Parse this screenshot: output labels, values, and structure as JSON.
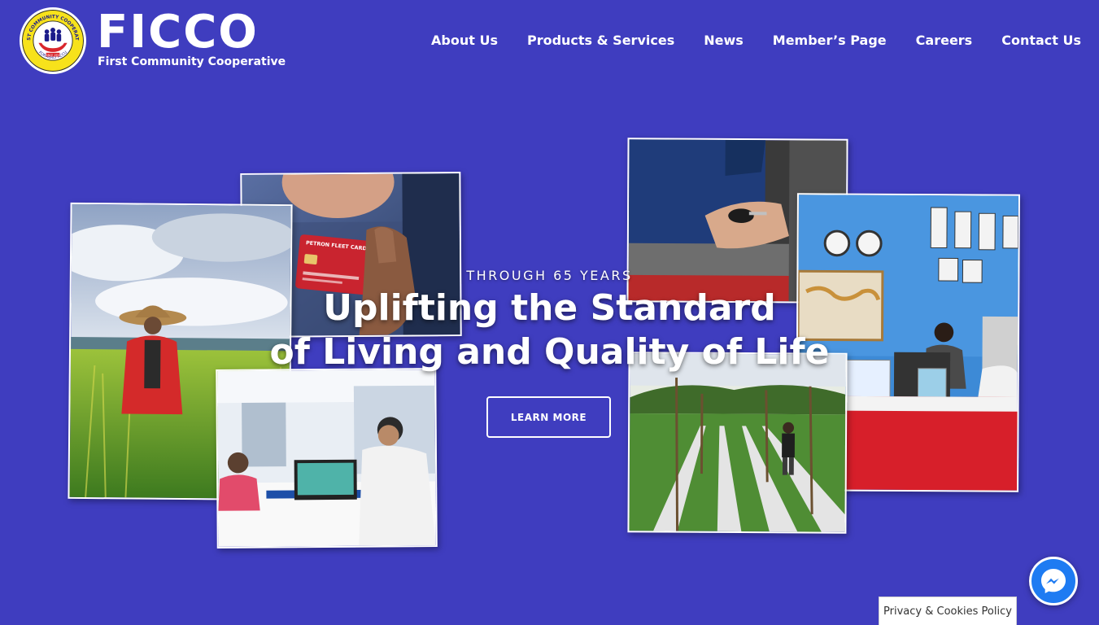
{
  "header": {
    "seal": {
      "ring_top_text": "FIRST COMMUNITY COOPERATIVE",
      "ring_bottom_text": "FORMERLY ACCU",
      "badge_text": "SINCE 1954"
    },
    "brand_name": "FICCO",
    "tagline": "First Community Cooperative"
  },
  "nav": {
    "items": [
      {
        "label": "About Us"
      },
      {
        "label": "Products & Services"
      },
      {
        "label": "News"
      },
      {
        "label": "Member’s Page"
      },
      {
        "label": "Careers"
      },
      {
        "label": "Contact Us"
      }
    ]
  },
  "hero": {
    "kicker": "THROUGH 65 YEARS",
    "title_line1": "Uplifting the Standard",
    "title_line2": "of Living and Quality of Life",
    "cta_label": "LEARN MORE",
    "photo_card_text": "PETRON FLEET CARD"
  },
  "widgets": {
    "privacy_label": "Privacy & Cookies Policy",
    "messenger_icon": "messenger-icon"
  },
  "colors": {
    "background": "#3f3dbf",
    "text": "#ffffff",
    "seal_yellow": "#f7e21b",
    "seal_red": "#d9262c",
    "messenger_blue": "#1e7bf2"
  }
}
